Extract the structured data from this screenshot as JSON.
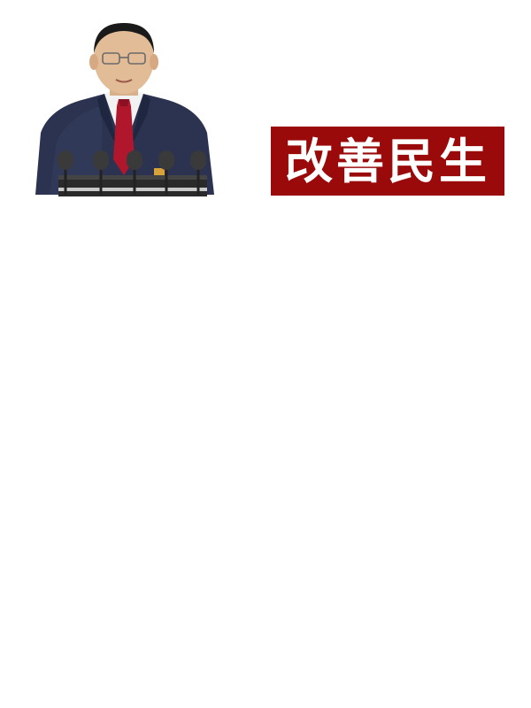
{
  "banner": {
    "text": "改善民生",
    "background_color": "#9b0a0a",
    "text_color": "#ffffff"
  },
  "photo": {
    "subject": "speaker-at-podium-with-microphones",
    "suit_color": "#2b3350",
    "tie_color": "#b0172c",
    "microphone_count": 5
  }
}
